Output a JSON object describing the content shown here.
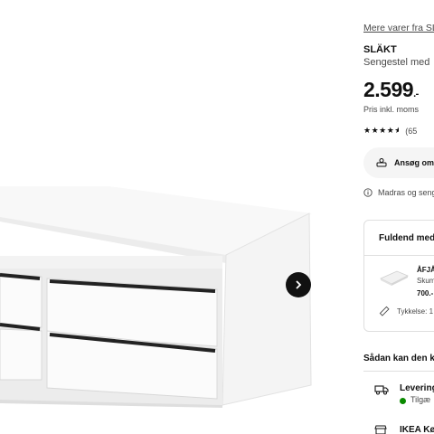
{
  "product": {
    "more_link": "Mere varer fra SL",
    "name": "SLÄKT",
    "description": "Sengestel med",
    "price_main": "2.599",
    "price_suffix": ".-",
    "vat_note": "Pris inkl. moms",
    "rating": 4.5,
    "reviews": "(65"
  },
  "actions": {
    "apply_label": "Ansøg om"
  },
  "info": {
    "note": "Madras og seng"
  },
  "complete": {
    "title": "Fuldend med",
    "item_name": "ÅFJÅ",
    "item_desc": "Skum",
    "item_price": "700.-",
    "thickness": "Tykkelse: 1"
  },
  "delivery": {
    "heading": "Sådan kan den k",
    "delivery_label": "Levering",
    "availability": "Tilgæ",
    "store": "IKEA Kø"
  },
  "colors": {
    "available": "#0a8a00",
    "button_dark": "#111111"
  }
}
